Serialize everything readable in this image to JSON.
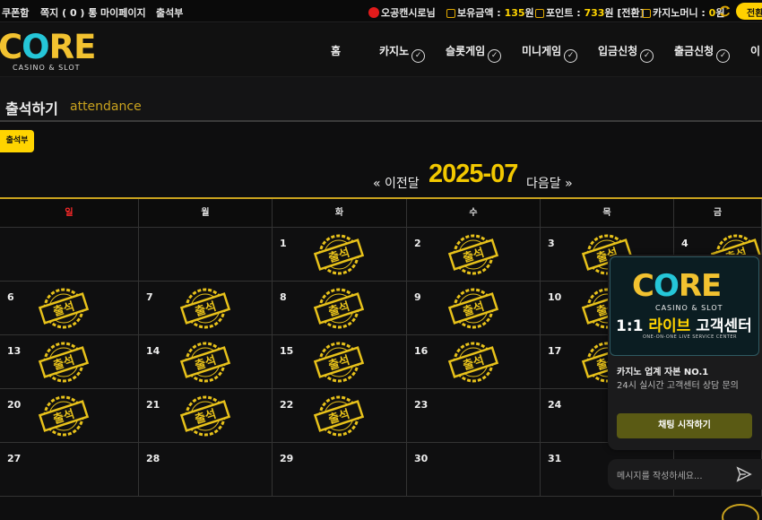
{
  "topbar": {
    "coupon": "쿠폰함",
    "note_prefix": "쪽지",
    "note_count": "( 0 )",
    "note_suffix": "통",
    "mypage": "마이페이지",
    "attendance": "출석부",
    "user_name": "오공캔시로님",
    "balance_label": "보유금액 :",
    "balance_value": "135",
    "balance_unit": "원",
    "point_label": "포인트 :",
    "point_value": "733",
    "point_unit": "원 [전환]",
    "casino_money_label": "카지노머니 :",
    "casino_money_value": "0",
    "casino_money_unit": "원",
    "exchange_button": "전환"
  },
  "logo": {
    "brand_c": "C",
    "brand_o": "O",
    "brand_re": "RE",
    "subtitle": "CASINO & SLOT"
  },
  "nav": {
    "home": "홈",
    "casino": "카지노",
    "slot": "슬롯게임",
    "mini": "미니게임",
    "deposit": "입금신청",
    "withdraw": "출금신청",
    "more": "이"
  },
  "page": {
    "title": "출석하기",
    "subtitle": "attendance",
    "tab": "출석부"
  },
  "calendar": {
    "prev": "« 이전달",
    "month": "2025-07",
    "next": "다음달 »",
    "weekdays": [
      "일",
      "월",
      "화",
      "수",
      "목",
      "금"
    ],
    "weekday_colors": [
      "#ff2a2a",
      "#dddddd",
      "#dddddd",
      "#dddddd",
      "#dddddd",
      "#dddddd"
    ],
    "stamp_text": "출석",
    "stamp_color": "#e8c21a",
    "weeks": [
      [
        {
          "day": "",
          "stamp": false
        },
        {
          "day": "",
          "stamp": false
        },
        {
          "day": "1",
          "stamp": true
        },
        {
          "day": "2",
          "stamp": true
        },
        {
          "day": "3",
          "stamp": true
        },
        {
          "day": "4",
          "stamp": true
        }
      ],
      [
        {
          "day": "6",
          "stamp": true
        },
        {
          "day": "7",
          "stamp": true
        },
        {
          "day": "8",
          "stamp": true
        },
        {
          "day": "9",
          "stamp": true
        },
        {
          "day": "10",
          "stamp": true
        },
        {
          "day": "",
          "stamp": false
        }
      ],
      [
        {
          "day": "13",
          "stamp": true
        },
        {
          "day": "14",
          "stamp": true
        },
        {
          "day": "15",
          "stamp": true
        },
        {
          "day": "16",
          "stamp": true
        },
        {
          "day": "17",
          "stamp": true
        },
        {
          "day": "",
          "stamp": false
        }
      ],
      [
        {
          "day": "20",
          "stamp": true
        },
        {
          "day": "21",
          "stamp": true
        },
        {
          "day": "22",
          "stamp": true
        },
        {
          "day": "23",
          "stamp": false
        },
        {
          "day": "24",
          "stamp": false
        },
        {
          "day": "",
          "stamp": false
        }
      ],
      [
        {
          "day": "27",
          "stamp": false
        },
        {
          "day": "28",
          "stamp": false
        },
        {
          "day": "29",
          "stamp": false
        },
        {
          "day": "30",
          "stamp": false
        },
        {
          "day": "31",
          "stamp": false
        },
        {
          "day": "",
          "stamp": false
        }
      ]
    ]
  },
  "chat": {
    "banner_brand_c": "C",
    "banner_brand_o": "O",
    "banner_brand_re": "RE",
    "banner_sub": "CASINO & SLOT",
    "banner_title_a": "1:1 ",
    "banner_title_b": "라이브",
    "banner_title_c": " 고객센터",
    "banner_service": "ONE-ON-ONE LIVE SERVICE CENTER",
    "headline": "카지노 업계 자본 NO.1",
    "desc": "24시 실시간 고객센터 상담 문의",
    "start_button": "채팅 시작하기",
    "input_placeholder": "메시지를 작성하세요...",
    "send_icon": "paper-plane-icon"
  }
}
